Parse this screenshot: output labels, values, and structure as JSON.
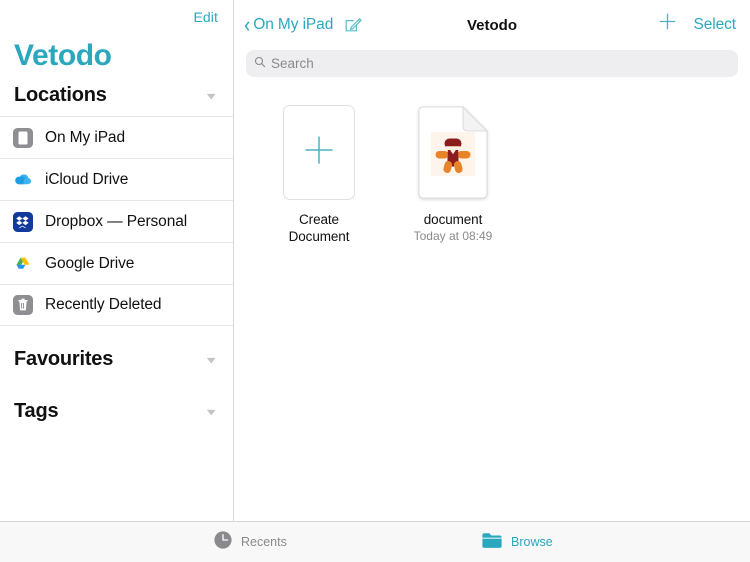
{
  "theme": {
    "accent": "#2ba8bd",
    "text_primary": "#111111",
    "text_secondary": "#8a8a8e",
    "tabbar_bg": "#f8f8f8",
    "search_bg": "#eeeef0"
  },
  "sidebar": {
    "edit_label": "Edit",
    "app_title": "Vetodo",
    "sections": [
      {
        "title": "Locations",
        "chevron": "chevron-down-icon"
      },
      {
        "title": "Favourites",
        "chevron": "chevron-down-icon"
      },
      {
        "title": "Tags",
        "chevron": "chevron-down-icon"
      }
    ],
    "locations": [
      {
        "label": "On My iPad",
        "icon": "ipad-device-icon"
      },
      {
        "label": "iCloud Drive",
        "icon": "icloud-drive-icon"
      },
      {
        "label": "Dropbox — Personal",
        "icon": "dropbox-icon"
      },
      {
        "label": "Google Drive",
        "icon": "google-drive-icon"
      },
      {
        "label": "Recently Deleted",
        "icon": "trash-icon"
      }
    ]
  },
  "navbar": {
    "back_label": "On My iPad",
    "back_icon": "chevron-left-icon",
    "compose_icon": "compose-icon",
    "title": "Vetodo",
    "add_icon": "plus-icon",
    "add_label": "+",
    "select_label": "Select"
  },
  "search": {
    "placeholder": "Search",
    "icon": "search-icon",
    "value": ""
  },
  "main": {
    "items": [
      {
        "type": "create",
        "icon": "plus-icon",
        "label_line1": "Create",
        "label_line2": "Document",
        "subtitle": ""
      },
      {
        "type": "document",
        "icon": "document-file-icon",
        "label_line1": "document",
        "label_line2": "",
        "subtitle": "Today at 08:49"
      }
    ]
  },
  "tabbar": {
    "tabs": [
      {
        "label": "Recents",
        "icon": "clock-icon",
        "active": false
      },
      {
        "label": "Browse",
        "icon": "folder-icon",
        "active": true
      }
    ]
  }
}
